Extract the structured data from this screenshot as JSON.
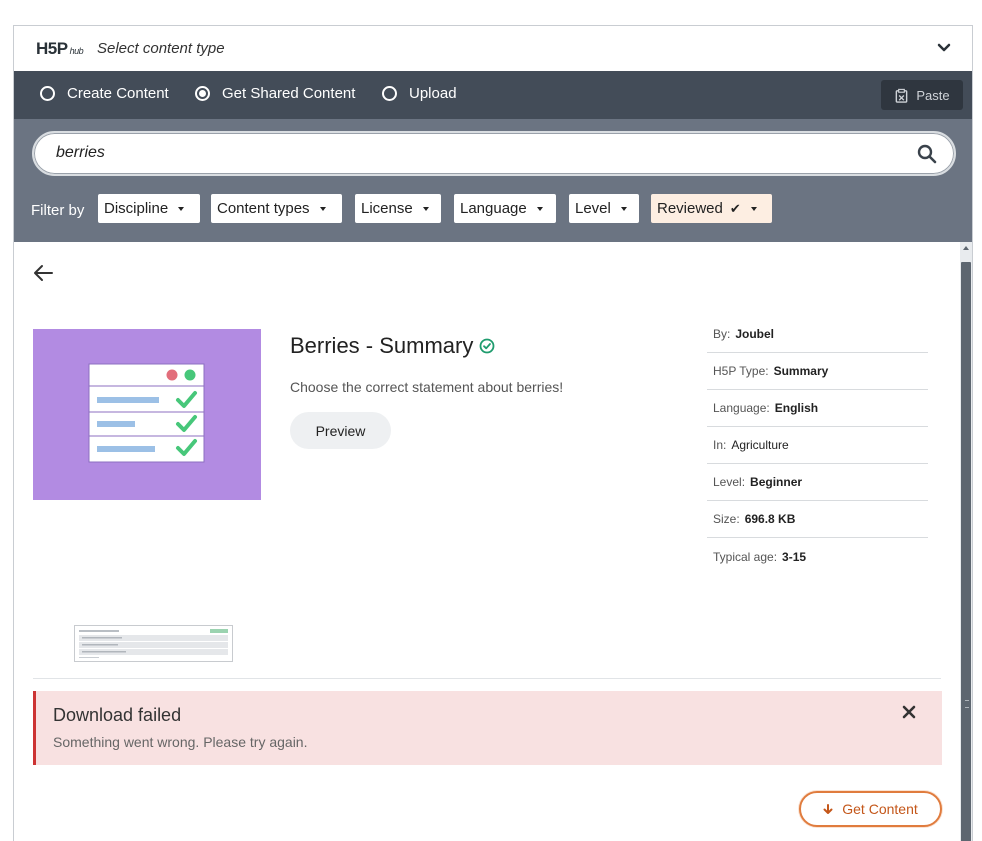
{
  "header": {
    "logo_text": "H5P",
    "logo_sub": "hub",
    "title": "Select content type",
    "toggle_icon": "chevron-down-icon"
  },
  "tabs": [
    {
      "label": "Create Content",
      "selected": false
    },
    {
      "label": "Get Shared Content",
      "selected": true
    },
    {
      "label": "Upload",
      "selected": false
    }
  ],
  "paste": {
    "label": "Paste",
    "icon": "clipboard-icon"
  },
  "search": {
    "value": "berries",
    "placeholder": "",
    "icon": "search-icon"
  },
  "filters": {
    "label": "Filter by",
    "items": [
      {
        "label": "Discipline"
      },
      {
        "label": "Content types"
      },
      {
        "label": "License"
      },
      {
        "label": "Language"
      },
      {
        "label": "Level"
      },
      {
        "label": "Reviewed",
        "check": "✔"
      }
    ]
  },
  "detail": {
    "title": "Berries - Summary",
    "description": "Choose the correct statement about berries!",
    "preview_label": "Preview",
    "meta": [
      {
        "label": "By:",
        "value": "Joubel"
      },
      {
        "label": "H5P Type:",
        "value": "Summary"
      },
      {
        "label": "Language:",
        "value": "English"
      },
      {
        "label": "In:",
        "value": "Agriculture"
      },
      {
        "label": "Level:",
        "value": "Beginner"
      },
      {
        "label": "Size:",
        "value": "696.8 KB"
      },
      {
        "label": "Typical age:",
        "value": "3-15"
      }
    ]
  },
  "alert": {
    "title": "Download failed",
    "message": "Something went wrong. Please try again."
  },
  "get_content": {
    "label": "Get Content",
    "icon": "download-arrow-icon"
  },
  "colors": {
    "tabs_bg": "#434c58",
    "search_bg": "#6b7482",
    "accent": "#e07c3e",
    "alert_bg": "#f8e1e1",
    "thumb_bg": "#b28be2"
  }
}
